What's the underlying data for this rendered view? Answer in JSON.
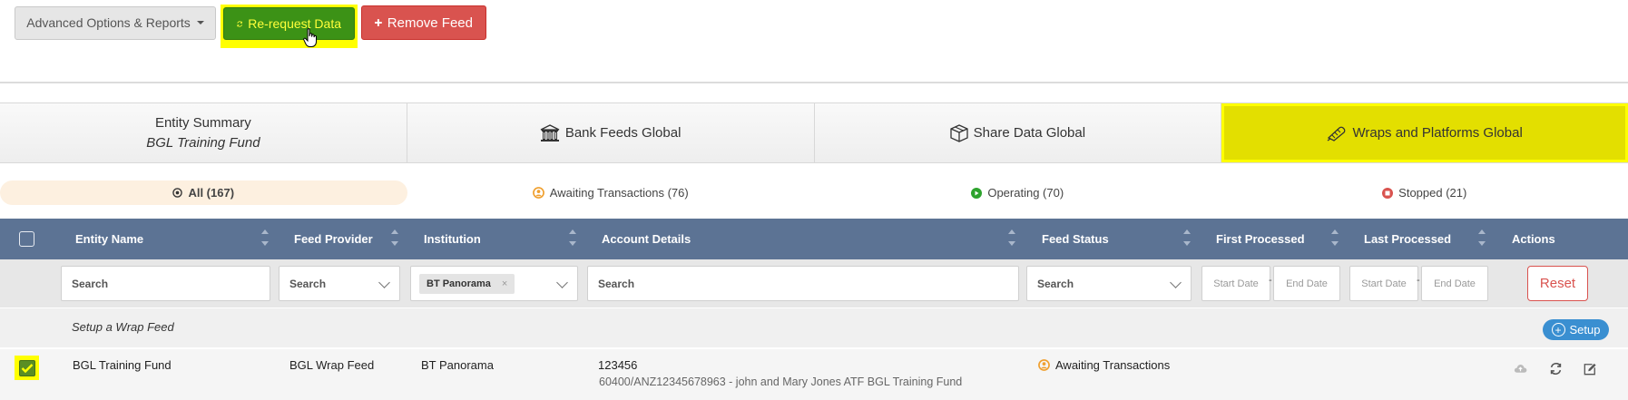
{
  "toolbar": {
    "advanced_label": "Advanced Options & Reports",
    "rerequest_label": "Re-request Data",
    "remove_label": "Remove Feed"
  },
  "tabs": [
    {
      "label": "Entity Summary",
      "sublabel": "BGL Training Fund"
    },
    {
      "label": "Bank Feeds Global",
      "icon": "bank-icon"
    },
    {
      "label": "Share Data Global",
      "icon": "box-icon"
    },
    {
      "label": "Wraps and Platforms Global",
      "icon": "wrap-icon",
      "active": true
    }
  ],
  "status_filters": [
    {
      "label": "All (167)",
      "icon": "target-icon",
      "active": true
    },
    {
      "label": "Awaiting Transactions (76)",
      "icon": "awaiting-icon",
      "color": "#f0a030"
    },
    {
      "label": "Operating (70)",
      "icon": "play-icon",
      "color": "#2ea32e"
    },
    {
      "label": "Stopped (21)",
      "icon": "stop-icon",
      "color": "#d9534f"
    }
  ],
  "columns": {
    "entity_name": "Entity Name",
    "feed_provider": "Feed Provider",
    "institution": "Institution",
    "account_details": "Account Details",
    "feed_status": "Feed Status",
    "first_processed": "First Processed",
    "last_processed": "Last Processed",
    "actions": "Actions"
  },
  "search": {
    "entity_placeholder": "Search",
    "provider_placeholder": "Search",
    "institution_chip": "BT Panorama",
    "institution_chip_remove": "×",
    "account_placeholder": "Search",
    "status_placeholder": "Search",
    "start_date": "Start Date",
    "end_date": "End Date",
    "date_separator": "-",
    "reset_label": "Reset"
  },
  "setup_row": {
    "label": "Setup a Wrap Feed",
    "button_label": "Setup",
    "button_icon": "+"
  },
  "rows": [
    {
      "checked": true,
      "entity_name": "BGL Training Fund",
      "feed_provider": "BGL Wrap Feed",
      "institution": "BT Panorama",
      "account_number": "123456",
      "account_description": "60400/ANZ12345678963 - john and Mary Jones ATF BGL Training Fund",
      "feed_status": "Awaiting Transactions",
      "status_color": "#f0a030"
    }
  ],
  "colors": {
    "header_bg": "#5c7394",
    "highlight": "#ffff00",
    "rerequest_bg": "#3c9216",
    "remove_bg": "#d9534f",
    "setup_bg": "#3a8fd1"
  }
}
